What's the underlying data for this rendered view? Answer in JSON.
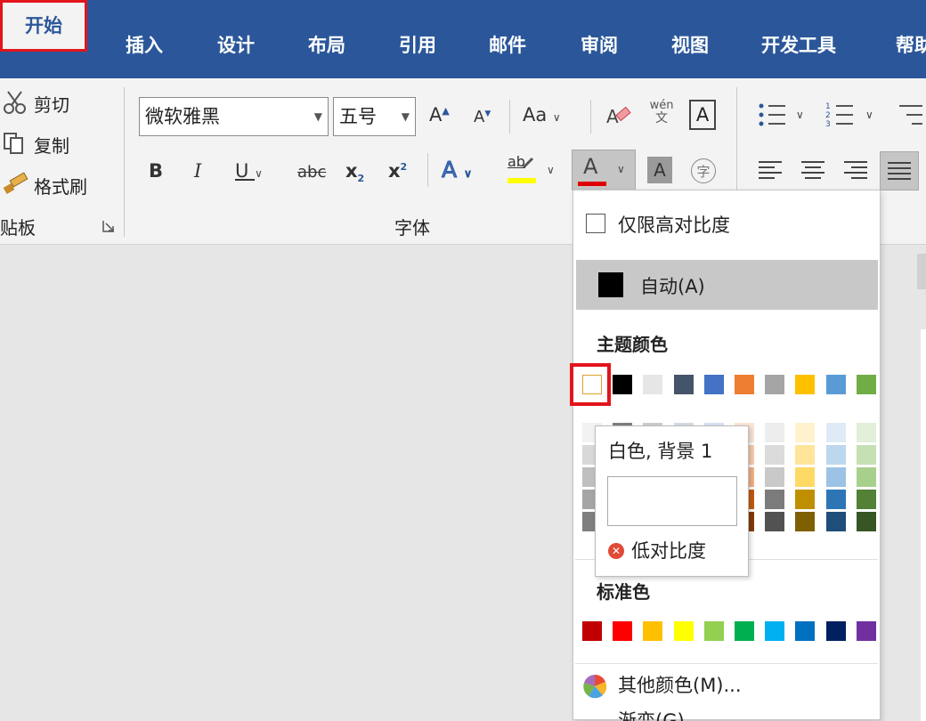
{
  "tabs": {
    "home": "开始",
    "insert": "插入",
    "design": "设计",
    "layout": "布局",
    "references": "引用",
    "mailings": "邮件",
    "review": "审阅",
    "view": "视图",
    "developer": "开发工具",
    "help": "帮助"
  },
  "clipboard": {
    "cut": "剪切",
    "copy": "复制",
    "format_painter": "格式刷",
    "group_label": "贴板"
  },
  "font": {
    "font_name": "微软雅黑",
    "font_size": "五号",
    "group_label": "字体",
    "grow": "A",
    "shrink": "A",
    "case": "Aa",
    "phonetic_top": "wén",
    "phonetic_bottom": "文",
    "border_char": "A",
    "bold": "B",
    "italic": "I",
    "underline": "U",
    "strike": "abc",
    "subscript": "x",
    "sub_small": "2",
    "superscript": "x",
    "sup_small": "2",
    "text_effects": "A",
    "highlight": "ab",
    "font_color": "A",
    "char_shading": "A",
    "enclose": "字",
    "highlight_color": "#ffff00",
    "font_color_bar": "#e00000"
  },
  "dropdown": {
    "high_contrast": "仅限高对比度",
    "auto": "自动(A)",
    "theme_title": "主题颜色",
    "standard_title": "标准色",
    "more_colors": "其他颜色(M)...",
    "gradient": "渐变(G)",
    "theme_colors": [
      "#ffffff",
      "#000000",
      "#e7e6e6",
      "#44546a",
      "#4472c4",
      "#ed7d31",
      "#a5a5a5",
      "#ffc000",
      "#5b9bd5",
      "#70ad47"
    ],
    "theme_shades": [
      [
        "#f2f2f2",
        "#7f7f7f",
        "#d0cece",
        "#d6dce4",
        "#d9e2f3",
        "#fbe5d5",
        "#ededed",
        "#fff2cc",
        "#deebf6",
        "#e2efd9"
      ],
      [
        "#d8d8d8",
        "#595959",
        "#aeabab",
        "#adb9ca",
        "#b4c6e7",
        "#f7cbac",
        "#dbdbdb",
        "#fee599",
        "#bdd7ee",
        "#c5e0b3"
      ],
      [
        "#bfbfbf",
        "#3f3f3f",
        "#757070",
        "#8496b0",
        "#8eaadb",
        "#f4b183",
        "#c9c9c9",
        "#ffd965",
        "#9cc3e5",
        "#a8d08d"
      ],
      [
        "#a5a5a5",
        "#262626",
        "#3a3838",
        "#323f4f",
        "#2f5496",
        "#c55a11",
        "#7b7b7b",
        "#bf8f00",
        "#2e75b5",
        "#538135"
      ],
      [
        "#7f7f7f",
        "#0c0c0c",
        "#171616",
        "#222a35",
        "#1f3864",
        "#833c0b",
        "#525252",
        "#7f6000",
        "#1e4e79",
        "#375623"
      ]
    ],
    "standard_colors": [
      "#c00000",
      "#ff0000",
      "#ffc000",
      "#ffff00",
      "#92d050",
      "#00b050",
      "#00b0f0",
      "#0070c0",
      "#002060",
      "#7030a0"
    ]
  },
  "tooltip": {
    "name": "白色, 背景 1",
    "warning": "低对比度"
  }
}
